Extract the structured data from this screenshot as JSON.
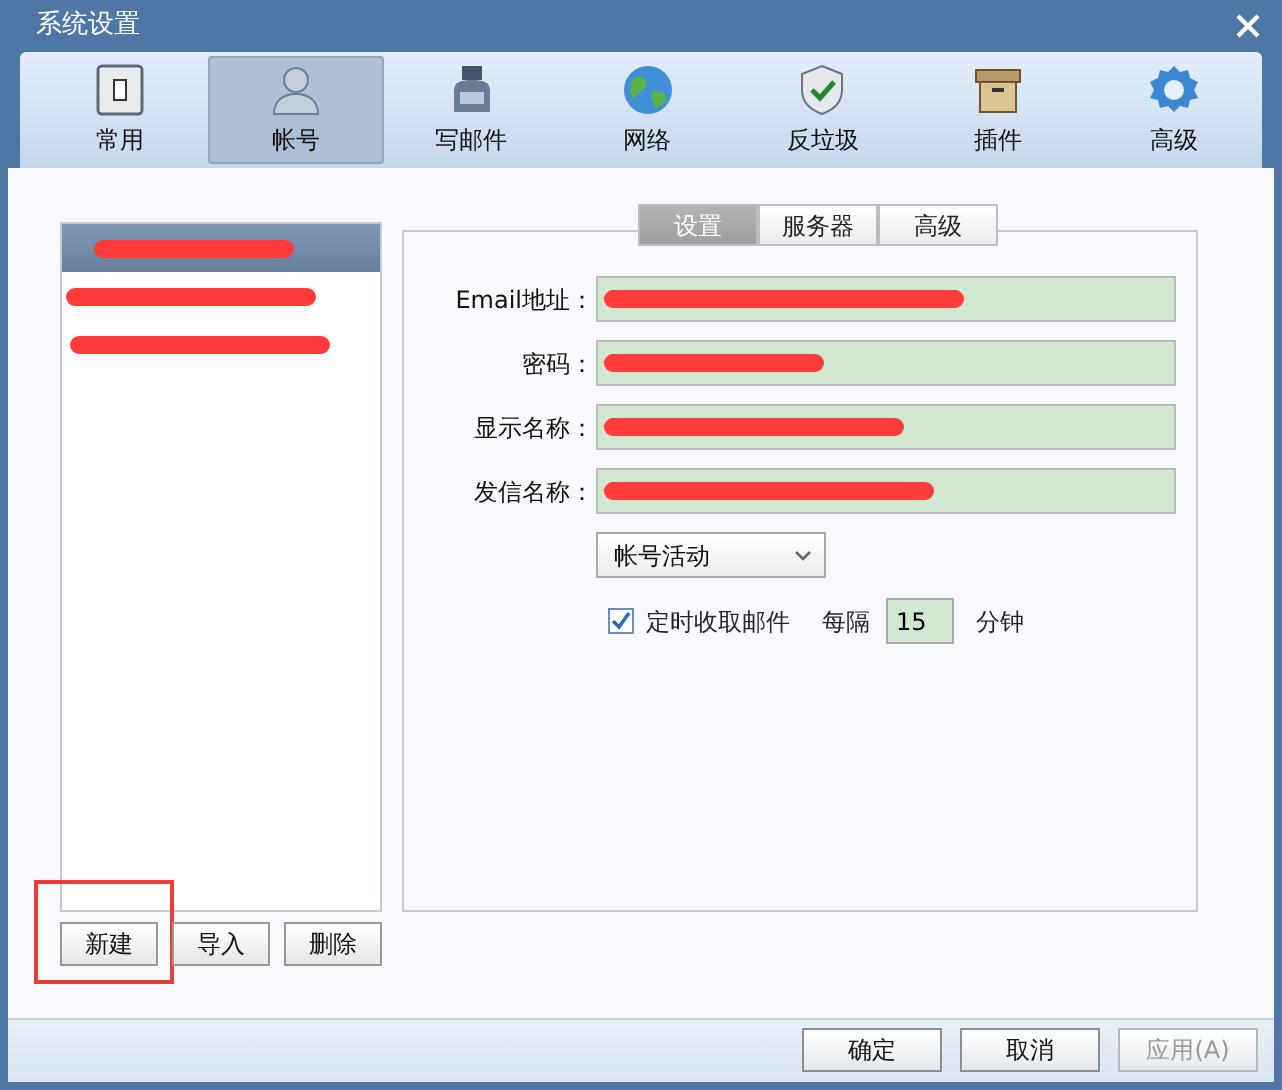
{
  "window": {
    "title": "系统设置"
  },
  "toolbar": [
    {
      "label": "常用",
      "kind": "general",
      "selected": false
    },
    {
      "label": "帐号",
      "kind": "account",
      "selected": true
    },
    {
      "label": "写邮件",
      "kind": "ink",
      "selected": false
    },
    {
      "label": "网络",
      "kind": "globe",
      "selected": false
    },
    {
      "label": "反垃圾",
      "kind": "shield",
      "selected": false
    },
    {
      "label": "插件",
      "kind": "box",
      "selected": false
    },
    {
      "label": "高级",
      "kind": "gear",
      "selected": false
    }
  ],
  "accounts": [
    {
      "selected": true
    },
    {
      "selected": false
    },
    {
      "selected": false
    }
  ],
  "subtabs": [
    {
      "label": "设置",
      "selected": true
    },
    {
      "label": "服务器",
      "selected": false
    },
    {
      "label": "高级",
      "selected": false
    }
  ],
  "fields": [
    {
      "label": "Email地址："
    },
    {
      "label": "密码："
    },
    {
      "label": "显示名称："
    },
    {
      "label": "发信名称："
    }
  ],
  "dropdown": {
    "value": "帐号活动"
  },
  "auto_check": {
    "label": "定时收取邮件",
    "checked": true,
    "every": "每隔",
    "interval": "15",
    "unit": "分钟"
  },
  "account_buttons": [
    {
      "label": "新建",
      "highlighted": true
    },
    {
      "label": "导入",
      "highlighted": false
    },
    {
      "label": "删除",
      "highlighted": false
    }
  ],
  "footer_buttons": [
    {
      "label": "确定",
      "disabled": false
    },
    {
      "label": "取消",
      "disabled": false
    },
    {
      "label": "应用(A)",
      "disabled": true
    }
  ]
}
